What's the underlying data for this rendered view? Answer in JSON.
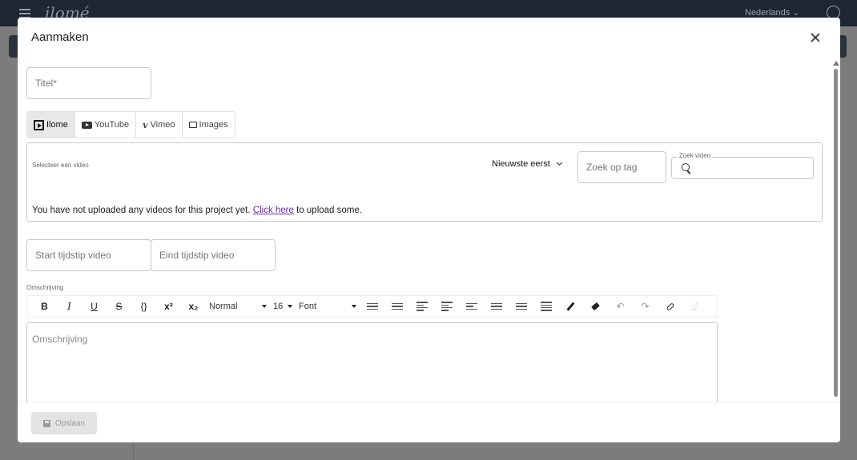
{
  "app": {
    "logo_text": "ilomé",
    "language": "Nederlands ⌄"
  },
  "modal": {
    "title": "Aanmaken",
    "title_field": {
      "placeholder": "Titel*",
      "value": ""
    },
    "source_tabs": [
      {
        "label": "Ilome",
        "icon": "ilome-play-icon",
        "active": true
      },
      {
        "label": "YouTube",
        "icon": "youtube-icon",
        "active": false
      },
      {
        "label": "Vimeo",
        "icon": "vimeo-icon",
        "active": false
      },
      {
        "label": "Images",
        "icon": "images-icon",
        "active": false
      }
    ],
    "video_picker": {
      "label": "Selecteer een video",
      "sort_label": "Nieuwste eerst",
      "tag_placeholder": "Zoek op tag",
      "search_legend": "Zoek video",
      "search_value": "",
      "empty_message_before": "You have not uploaded any videos for this project yet.",
      "empty_message_link": "Click here",
      "empty_message_after": "to upload some."
    },
    "start_time": {
      "placeholder": "Start tijdstip video",
      "value": ""
    },
    "end_time": {
      "placeholder": "Eind tijdstip video",
      "value": ""
    },
    "description": {
      "label": "Omschrijving",
      "placeholder": "Omschrijving",
      "toolbar": {
        "bold": "B",
        "italic": "I",
        "underline": "U",
        "strike": "S",
        "code": "{}",
        "superscript": "x²",
        "subscript": "x₂",
        "heading_select": "Normal",
        "size_select": "16",
        "font_select": "Font",
        "undo": "↶",
        "redo": "↷"
      }
    },
    "save_label": "Opslaan"
  },
  "colors": {
    "topbar": "#1e2633",
    "link": "#6a2fa0",
    "active_tab": "#e8e8e8",
    "disabled_button": "#e3e3e3"
  }
}
